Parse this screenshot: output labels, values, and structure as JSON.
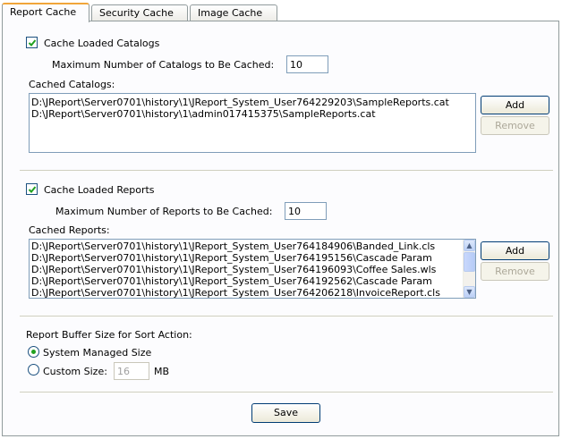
{
  "tabs": [
    {
      "label": "Report Cache",
      "active": true
    },
    {
      "label": "Security Cache",
      "active": false
    },
    {
      "label": "Image Cache",
      "active": false
    }
  ],
  "catalogs": {
    "cache_label": "Cache Loaded Catalogs",
    "cache_checked": true,
    "max_label": "Maximum Number of Catalogs to Be Cached:",
    "max_value": "10",
    "list_label": "Cached Catalogs:",
    "items": [
      "D:\\JReport\\Server0701\\history\\1\\JReport_System_User764229203\\SampleReports.cat",
      "D:\\JReport\\Server0701\\history\\1\\admin017415375\\SampleReports.cat"
    ],
    "add_label": "Add",
    "remove_label": "Remove"
  },
  "reports": {
    "cache_label": "Cache Loaded Reports",
    "cache_checked": true,
    "max_label": "Maximum Number of Reports to Be Cached:",
    "max_value": "10",
    "list_label": "Cached Reports:",
    "items": [
      "D:\\JReport\\Server0701\\history\\1\\JReport_System_User764184906\\Banded_Link.cls",
      "D:\\JReport\\Server0701\\history\\1\\JReport_System_User764195156\\Cascade Param",
      "D:\\JReport\\Server0701\\history\\1\\JReport_System_User764196093\\Coffee Sales.wls",
      "D:\\JReport\\Server0701\\history\\1\\JReport_System_User764192562\\Cascade Param",
      "D:\\JReport\\Server0701\\history\\1\\JReport_System_User764206218\\InvoiceReport.cls"
    ],
    "add_label": "Add",
    "remove_label": "Remove"
  },
  "buffer": {
    "label": "Report Buffer Size for Sort Action:",
    "system_label": "System Managed Size",
    "custom_label": "Custom Size:",
    "custom_value": "16",
    "unit": "MB",
    "selected": "system"
  },
  "save_label": "Save",
  "colors": {
    "tab_accent": "#f1a53a",
    "radio_dot": "#21a121",
    "border": "#7f9db9"
  }
}
